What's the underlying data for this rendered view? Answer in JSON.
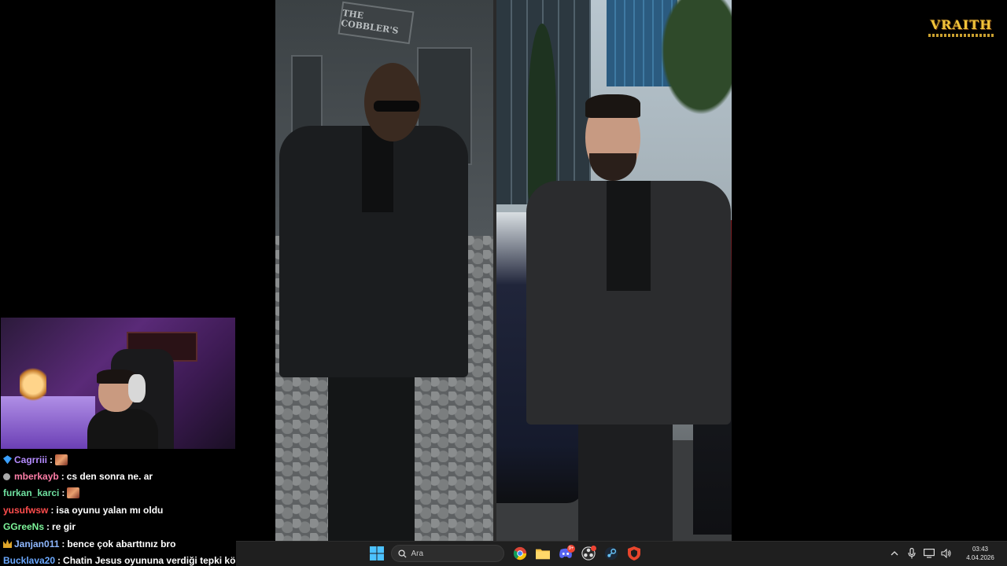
{
  "stream_overlay": {
    "logo_text": "VRAITH"
  },
  "main_image": {
    "game_panel": {
      "sign_text": "THE COBBLER'S"
    }
  },
  "chat": {
    "messages": [
      {
        "user": "Cagrriii",
        "user_color": "#b58cff",
        "badge": "diamond-icon",
        "text": "",
        "emote": true
      },
      {
        "user": "mberkayb",
        "user_color": "#ff7ea8",
        "badge": "gear-icon",
        "text": "cs den sonra ne. ar",
        "emote": false
      },
      {
        "user": "furkan_karci",
        "user_color": "#6fe0a0",
        "badge": "",
        "text": "",
        "emote": true
      },
      {
        "user": "yusufwsw",
        "user_color": "#ff4d4d",
        "badge": "",
        "text": "isa oyunu yalan mı oldu",
        "emote": false
      },
      {
        "user": "GGreeNs",
        "user_color": "#7df59a",
        "badge": "",
        "text": "re gir",
        "emote": false
      },
      {
        "user": "Janjan011",
        "user_color": "#8fb8ff",
        "badge": "crown-icon",
        "text": "bence çok abarttınız bro",
        "emote": false
      },
      {
        "user": "Bucklava20",
        "user_color": "#6aa8ff",
        "badge": "",
        "text": "Chatin Jesus oyununa verdiği tepki kö",
        "emote": false
      }
    ]
  },
  "taskbar": {
    "search_placeholder": "Ara",
    "discord_badge": "9+",
    "clock_time": "03:43",
    "clock_date": "4.04.2026"
  }
}
